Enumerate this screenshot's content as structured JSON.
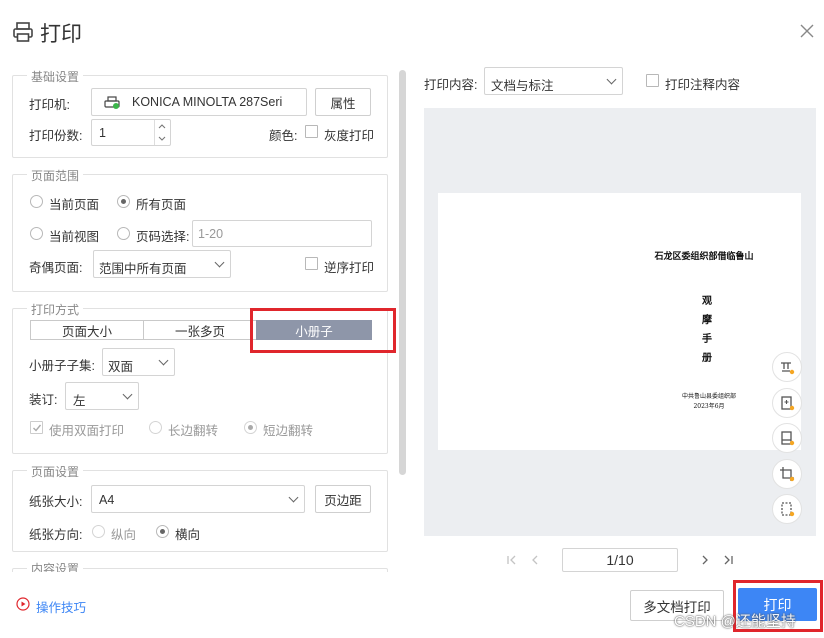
{
  "dialog": {
    "title": "打印"
  },
  "basic": {
    "legend": "基础设置",
    "printer_label": "打印机:",
    "printer_value": "KONICA MINOLTA 287Seri",
    "properties_btn": "属性",
    "copies_label": "打印份数:",
    "copies_value": "1",
    "color_label": "颜色:",
    "gray_label": "灰度打印"
  },
  "range": {
    "legend": "页面范围",
    "current_page": "当前页面",
    "all_pages": "所有页面",
    "current_view": "当前视图",
    "page_select": "页码选择:",
    "page_select_placeholder": "1-20",
    "odd_even_label": "奇偶页面:",
    "odd_even_value": "范围中所有页面",
    "reverse_label": "逆序打印"
  },
  "mode": {
    "legend": "打印方式",
    "tabs": [
      "页面大小",
      "一张多页",
      "小册子"
    ],
    "active_tab": 2,
    "subset_label": "小册子子集:",
    "subset_value": "双面",
    "binding_label": "装订:",
    "binding_value": "左",
    "duplex_label": "使用双面打印",
    "long_edge": "长边翻转",
    "short_edge": "短边翻转"
  },
  "page_setup": {
    "legend": "页面设置",
    "paper_label": "纸张大小:",
    "paper_value": "A4",
    "margins_btn": "页边距",
    "orient_label": "纸张方向:",
    "portrait": "纵向",
    "landscape": "横向"
  },
  "content": {
    "legend": "内容设置"
  },
  "footer": {
    "tips_link": "操作技巧",
    "multi_btn": "多文档打印",
    "print_btn": "打印",
    "watermark": "CSDN @还能坚持"
  },
  "right": {
    "content_label": "打印内容:",
    "content_value": "文档与标注",
    "annot_label": "打印注释内容",
    "page_indicator": "1/10"
  },
  "doc": {
    "org": "石龙区委组织部借临鲁山",
    "title_chars": [
      "观",
      "摩",
      "手",
      "册"
    ],
    "footer_line1": "中共鲁山县委组织部",
    "footer_line2": "2023年6月"
  },
  "colors": {
    "accent": "#3d86f5",
    "highlight": "#e0262c",
    "segment_active": "#8e96a9"
  }
}
